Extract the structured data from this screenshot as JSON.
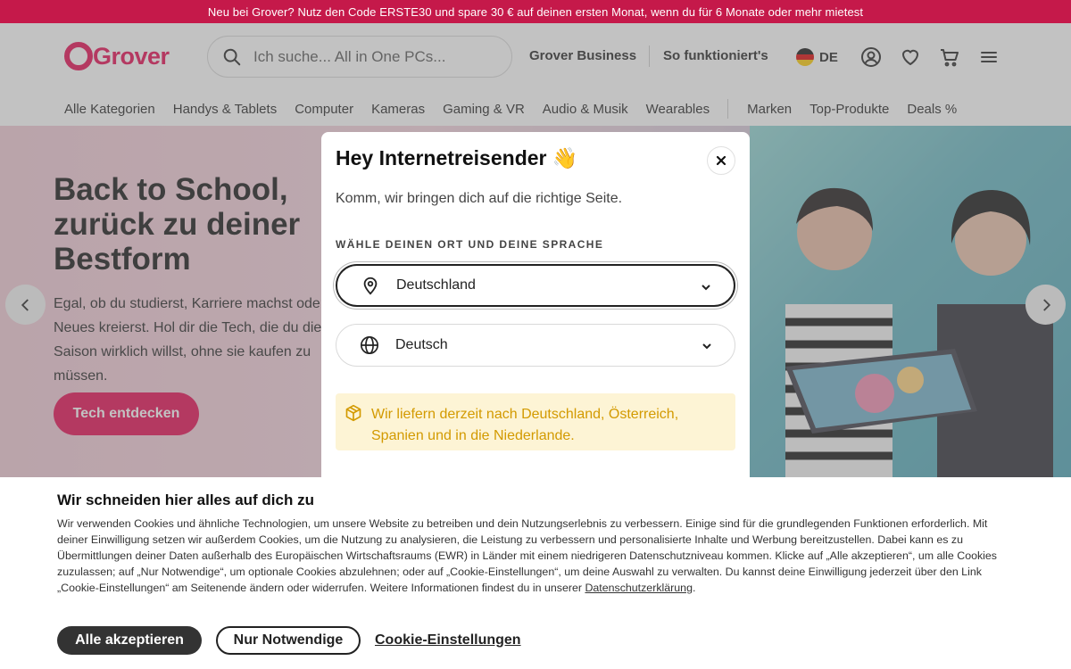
{
  "promo": {
    "text": "Neu bei Grover? Nutz den Code ERSTE30 und spare 30 € auf deinen ersten Monat, wenn du für 6 Monate oder mehr mietest"
  },
  "header": {
    "logo": "Grover",
    "search_placeholder": "Ich suche... All in One PCs...",
    "links": {
      "business": "Grover Business",
      "how": "So funktioniert's"
    },
    "language_code": "DE"
  },
  "nav": {
    "items": [
      "Alle Kategorien",
      "Handys & Tablets",
      "Computer",
      "Kameras",
      "Gaming & VR",
      "Audio & Musik",
      "Wearables"
    ],
    "items_right": [
      "Marken",
      "Top-Produkte",
      "Deals %"
    ]
  },
  "hero": {
    "title": "Back to School, zurück zu deiner Bestform",
    "text": "Egal, ob du studierst, Karriere machst oder Neues kreierst. Hol dir die Tech, die du diese Saison wirklich willst, ohne sie kaufen zu müssen.",
    "cta": "Tech entdecken"
  },
  "modal": {
    "title": "Hey Internetreisender 👋",
    "subtitle": "Komm, wir bringen dich auf die richtige Seite.",
    "section_label": "WÄHLE DEINEN ORT UND DEINE SPRACHE",
    "country": "Deutschland",
    "language": "Deutsch",
    "notice": "Wir liefern derzeit nach Deutschland, Österreich, Spanien und in die Niederlande."
  },
  "cookie": {
    "title": "Wir schneiden hier alles auf dich zu",
    "body": "Wir verwenden Cookies und ähnliche Technologien, um unsere Website zu betreiben und dein Nutzungserlebnis zu verbessern. Einige sind für die grundlegenden Funktionen erforderlich. Mit deiner Einwilligung setzen wir außerdem Cookies, um die Nutzung zu analysieren, die Leistung zu verbessern und personalisierte Inhalte und Werbung bereitzustellen. Dabei kann es zu Übermittlungen deiner Daten außerhalb des Europäischen Wirtschaftsraums (EWR) in Länder mit einem niedrigeren Datenschutzniveau kommen. Klicke auf „Alle akzeptieren“, um alle Cookies zuzulassen; auf „Nur Notwendige“, um optionale Cookies abzulehnen; oder auf „Cookie-Einstellungen“, um deine Auswahl zu verwalten. Du kannst deine Einwilligung jederzeit über den Link „Cookie-Einstellungen“ am Seitenende ändern oder widerrufen. Weitere Informationen findest du in unserer",
    "privacy_link": "Datenschutzerklärung",
    "accept_all": "Alle akzeptieren",
    "necessary_only": "Nur Notwendige",
    "settings": "Cookie-Einstellungen"
  },
  "colors": {
    "brand": "#e5074f",
    "promo_bg": "#c5194a",
    "notice_bg": "#fdf4d5",
    "notice_text": "#d39a00"
  }
}
